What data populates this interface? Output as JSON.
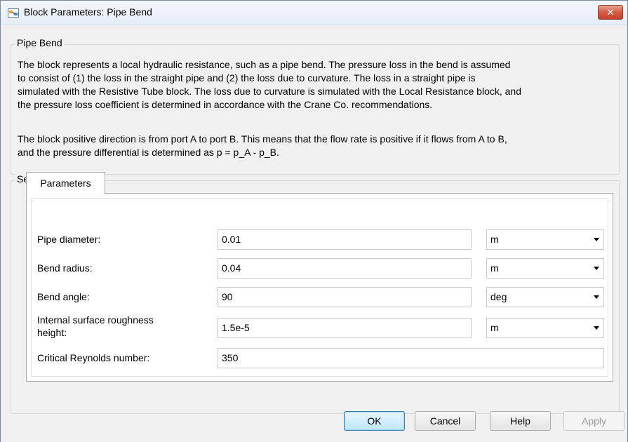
{
  "window": {
    "title": "Block Parameters: Pipe Bend",
    "close_label": "✕"
  },
  "description_group": {
    "legend": "Pipe Bend",
    "paragraph1": [
      "The block represents a local hydraulic resistance, such as a pipe bend. The pressure loss in the bend is assumed",
      "to consist of (1) the loss in the straight pipe and (2) the loss due to curvature. The loss in a straight pipe is",
      "simulated with the Resistive Tube block. The loss due to curvature is simulated with the Local Resistance block, and",
      "the pressure loss coefficient is determined in accordance with the Crane Co. recommendations."
    ],
    "paragraph2": [
      "The block positive direction is from port A to port B. This means that the flow rate is positive if it flows from A to B,",
      "and the pressure differential is determined as p = p_A - p_B."
    ]
  },
  "settings_group": {
    "legend": "Settings",
    "tab_label": "Parameters",
    "params": [
      {
        "label": "Pipe diameter:",
        "value": "0.01",
        "unit": "m"
      },
      {
        "label": "Bend radius:",
        "value": "0.04",
        "unit": "m"
      },
      {
        "label": "Bend angle:",
        "value": "90",
        "unit": "deg"
      },
      {
        "label_line1": "Internal surface roughness",
        "label_line2": "height:",
        "value": "1.5e-5",
        "unit": "m"
      },
      {
        "label": "Critical Reynolds number:",
        "value": "350"
      }
    ]
  },
  "buttons": {
    "ok": "OK",
    "cancel": "Cancel",
    "help": "Help",
    "apply": "Apply"
  }
}
